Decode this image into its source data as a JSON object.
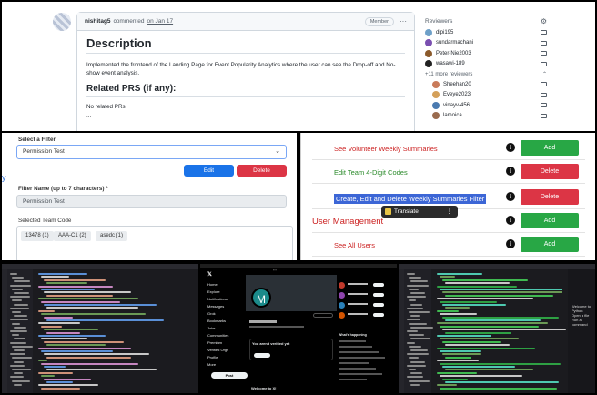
{
  "github": {
    "author": "nishitag5",
    "commented": "commented",
    "date": "on Jan 17",
    "role_badge": "Member",
    "heading": "Description",
    "description": "Implemented the frontend of the Landing Page for Event Popularity Analytics where the user can see the Drop-off and No-show event analysis.",
    "related_heading": "Related PRS (if any):",
    "related_text": "No related PRs",
    "related_dots": "...",
    "reviewers_title": "Reviewers",
    "reviewers": [
      {
        "name": "dipi195",
        "color": "#6ea0c8"
      },
      {
        "name": "sundarmachani",
        "color": "#7a4fb0"
      },
      {
        "name": "Peter-Nie2003",
        "color": "#8b5a2b"
      },
      {
        "name": "wasawi-189",
        "color": "#222222"
      }
    ],
    "more_reviewers": "+11 more reviewers",
    "more_list": [
      {
        "name": "Sheehan20",
        "color": "#c97b5a"
      },
      {
        "name": "Eveye2023",
        "color": "#d4a05a"
      },
      {
        "name": "vinayv-456",
        "color": "#4a7ab0"
      },
      {
        "name": "lamoica",
        "color": "#9a6b4e"
      }
    ]
  },
  "filter": {
    "select_label": "Select a Filter",
    "select_value": "Permission Test",
    "edit_label": "Edit",
    "delete_label": "Delete",
    "name_label": "Filter Name (up to 7 characters) *",
    "name_value": "Permission Test",
    "codes_label": "Selected Team Code",
    "codes": [
      "13478 (1)",
      "AAA-C1 (2)",
      "asedc (1)"
    ]
  },
  "permissions": {
    "rows": [
      {
        "label": "See Volunteer Weekly Summaries",
        "color": "#cc2222",
        "button": "Add",
        "btn_color": "#28a745"
      },
      {
        "label": "Edit Team 4-Digit Codes",
        "color": "#2a8a2a",
        "button": "Delete",
        "btn_color": "#dc3545"
      },
      {
        "label": "Create, Edit and Delete Weekly Summaries Filter",
        "color": "#ffffff",
        "button": "Delete",
        "btn_color": "#dc3545"
      }
    ],
    "section": "User Management",
    "section_rows": [
      {
        "label": "",
        "color": "#cc2222",
        "button": "Add",
        "btn_color": "#28a745"
      },
      {
        "label": "See All Users",
        "color": "#cc2222",
        "button": "Add",
        "btn_color": "#28a745"
      }
    ],
    "translate_label": "Translate",
    "translate_dots": "⋮"
  },
  "twitter": {
    "nav": [
      "Home",
      "Explore",
      "Notifications",
      "Messages",
      "Grok",
      "Bookmarks",
      "Jobs",
      "Communities",
      "Premium",
      "Verified Orgs",
      "Profile",
      "More"
    ],
    "post_label": "Post",
    "avatar_letter": "M",
    "verified_title": "You aren't verified yet",
    "verified_btn": "Get verified",
    "welcome": "Welcome to X!",
    "right_title": "What's happening"
  },
  "vscode": {
    "welcome_line1": "Welcome to Python",
    "welcome_line2": "Open a file",
    "welcome_line3": "Run a command"
  }
}
